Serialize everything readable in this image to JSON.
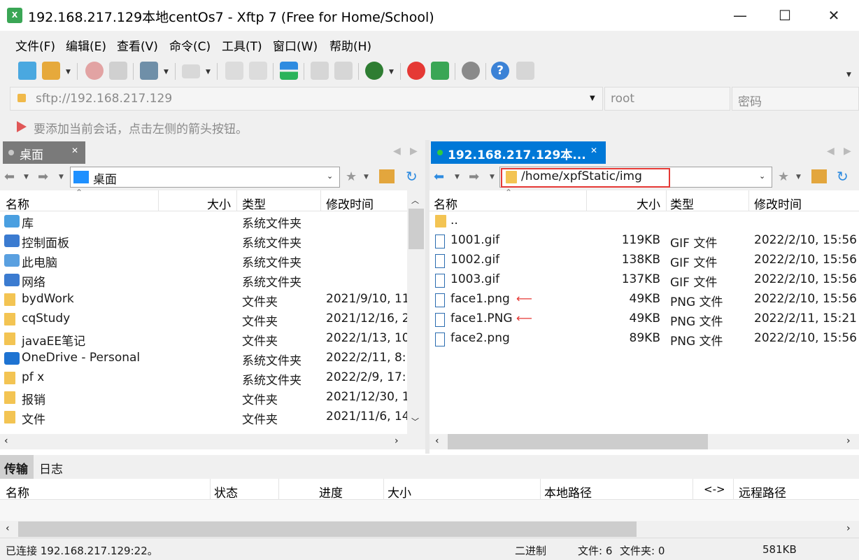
{
  "window": {
    "title": "192.168.217.129本地centOs7 - Xftp 7 (Free for Home/School)",
    "minimize": "—",
    "maximize": "☐",
    "close": "✕"
  },
  "menu": [
    "文件(F)",
    "编辑(E)",
    "查看(V)",
    "命令(C)",
    "工具(T)",
    "窗口(W)",
    "帮助(H)"
  ],
  "address": {
    "url": "sftp://192.168.217.129",
    "user_placeholder": "root",
    "password_placeholder": "密码"
  },
  "hint": "要添加当前会话，点击左侧的箭头按钮。",
  "left_pane": {
    "tab": "桌面",
    "path": "桌面",
    "columns": [
      "名称",
      "大小",
      "类型",
      "修改时间"
    ],
    "rows": [
      {
        "name": "库",
        "size": "",
        "type": "系统文件夹",
        "modified": "",
        "icon": "library-icon"
      },
      {
        "name": "控制面板",
        "size": "",
        "type": "系统文件夹",
        "modified": "",
        "icon": "control-panel-icon"
      },
      {
        "name": "此电脑",
        "size": "",
        "type": "系统文件夹",
        "modified": "",
        "icon": "computer-icon"
      },
      {
        "name": "网络",
        "size": "",
        "type": "系统文件夹",
        "modified": "",
        "icon": "network-icon"
      },
      {
        "name": "bydWork",
        "size": "",
        "type": "文件夹",
        "modified": "2021/9/10, 11",
        "icon": "folder-icon"
      },
      {
        "name": "cqStudy",
        "size": "",
        "type": "文件夹",
        "modified": "2021/12/16, 2",
        "icon": "folder-icon"
      },
      {
        "name": "javaEE笔记",
        "size": "",
        "type": "文件夹",
        "modified": "2022/1/13, 10",
        "icon": "folder-icon"
      },
      {
        "name": "OneDrive - Personal",
        "size": "",
        "type": "系统文件夹",
        "modified": "2022/2/11, 8:",
        "icon": "onedrive-icon"
      },
      {
        "name": "pf x",
        "size": "",
        "type": "系统文件夹",
        "modified": "2022/2/9, 17:",
        "icon": "user-folder-icon"
      },
      {
        "name": "报销",
        "size": "",
        "type": "文件夹",
        "modified": "2021/12/30, 1",
        "icon": "folder-icon"
      },
      {
        "name": "文件",
        "size": "",
        "type": "文件夹",
        "modified": "2021/11/6, 14",
        "icon": "folder-icon"
      }
    ]
  },
  "right_pane": {
    "tab": "192.168.217.129本...",
    "path": "/home/xpfStatic/img",
    "columns": [
      "名称",
      "大小",
      "类型",
      "修改时间"
    ],
    "rows": [
      {
        "name": "..",
        "size": "",
        "type": "",
        "modified": "",
        "icon": "folder-icon"
      },
      {
        "name": "1001.gif",
        "size": "119KB",
        "type": "GIF 文件",
        "modified": "2022/2/10, 15:56",
        "icon": "image-file-icon"
      },
      {
        "name": "1002.gif",
        "size": "138KB",
        "type": "GIF 文件",
        "modified": "2022/2/10, 15:56",
        "icon": "image-file-icon"
      },
      {
        "name": "1003.gif",
        "size": "137KB",
        "type": "GIF 文件",
        "modified": "2022/2/10, 15:56",
        "icon": "image-file-icon"
      },
      {
        "name": "face1.png",
        "size": "49KB",
        "type": "PNG 文件",
        "modified": "2022/2/10, 15:56",
        "icon": "image-file-icon",
        "marked": true
      },
      {
        "name": "face1.PNG",
        "size": "49KB",
        "type": "PNG 文件",
        "modified": "2022/2/11, 15:21",
        "icon": "image-file-icon",
        "marked": true
      },
      {
        "name": "face2.png",
        "size": "89KB",
        "type": "PNG 文件",
        "modified": "2022/2/10, 15:56",
        "icon": "image-file-icon"
      }
    ]
  },
  "transfer": {
    "tabs": [
      "传输",
      "日志"
    ],
    "columns": [
      "名称",
      "状态",
      "进度",
      "大小",
      "本地路径",
      "<->",
      "远程路径"
    ]
  },
  "status": {
    "connection": "已连接 192.168.217.129:22。",
    "mode": "二进制",
    "files": "文件: 6",
    "folders": "文件夹: 0",
    "total": "581KB"
  },
  "colors": {
    "accent": "#0078d7",
    "active_tab": "#0078d7",
    "inactive_tab": "#7a7a7a",
    "highlight_box": "#e53935",
    "arrow": "#e53935"
  }
}
